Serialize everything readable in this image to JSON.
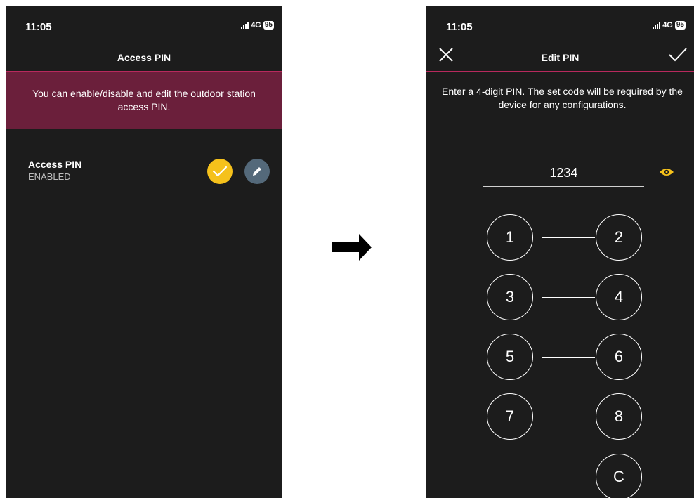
{
  "left_screen": {
    "status": {
      "time": "11:05",
      "network": "4G",
      "battery": "95"
    },
    "title": "Access PIN",
    "banner": "You can enable/disable and edit the outdoor station access PIN.",
    "access_pin": {
      "label": "Access PIN",
      "status": "ENABLED"
    },
    "icons": {
      "toggle": "check-circle-icon",
      "edit": "pencil-icon"
    }
  },
  "right_screen": {
    "status": {
      "time": "11:05",
      "network": "4G",
      "battery": "95"
    },
    "title": "Edit PIN",
    "instruction": "Enter a 4-digit PIN. The set code will be required by the device for any configurations.",
    "pin_value": "1234",
    "keys": [
      "1",
      "2",
      "3",
      "4",
      "5",
      "6",
      "7",
      "8",
      "C"
    ],
    "icons": {
      "close": "close-icon",
      "save": "checkmark-icon",
      "reveal": "eye-icon"
    }
  },
  "colors": {
    "accent": "#b8295d",
    "banner": "#6b1f3b",
    "toggle": "#f5c11b",
    "edit": "#54697a",
    "eye": "#f5c11b"
  }
}
